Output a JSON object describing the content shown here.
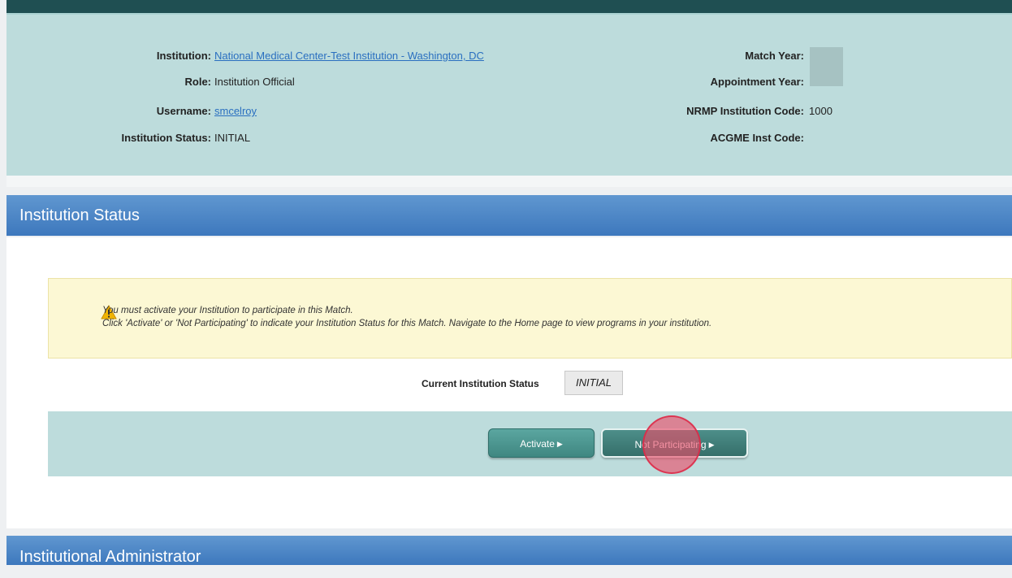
{
  "info": {
    "institution_label": "Institution:",
    "institution_value": "National Medical Center-Test Institution - Washington, DC",
    "role_label": "Role:",
    "role_value": "Institution Official",
    "username_label": "Username:",
    "username_value": "smcelroy",
    "status_label": "Institution Status:",
    "status_value": "INITIAL",
    "match_year_label": "Match Year:",
    "appointment_year_label": "Appointment Year:",
    "nrmp_code_label": "NRMP Institution Code:",
    "nrmp_code_value": "1000",
    "acgme_label": "ACGME Inst Code:"
  },
  "status_section": {
    "title": "Institution Status",
    "warning_line1": "You must activate your Institution to participate in this Match.",
    "warning_line2": "Click 'Activate' or 'Not Participating' to indicate your Institution Status for this Match. Navigate to the Home page to view programs in your institution.",
    "current_label": "Current Institution Status",
    "current_value": "INITIAL",
    "activate_label": "Activate",
    "not_participating_label": "Not Participating"
  },
  "admin_section": {
    "title": "Institutional Administrator"
  },
  "colors": {
    "header_blue": "#3d78bd",
    "info_panel": "#bddcdc",
    "button_teal": "#3f8781",
    "warning_bg": "#fcf8d4",
    "click_marker": "#ec4c68"
  },
  "icons": [
    "warning-icon",
    "arrow-right-icon"
  ]
}
